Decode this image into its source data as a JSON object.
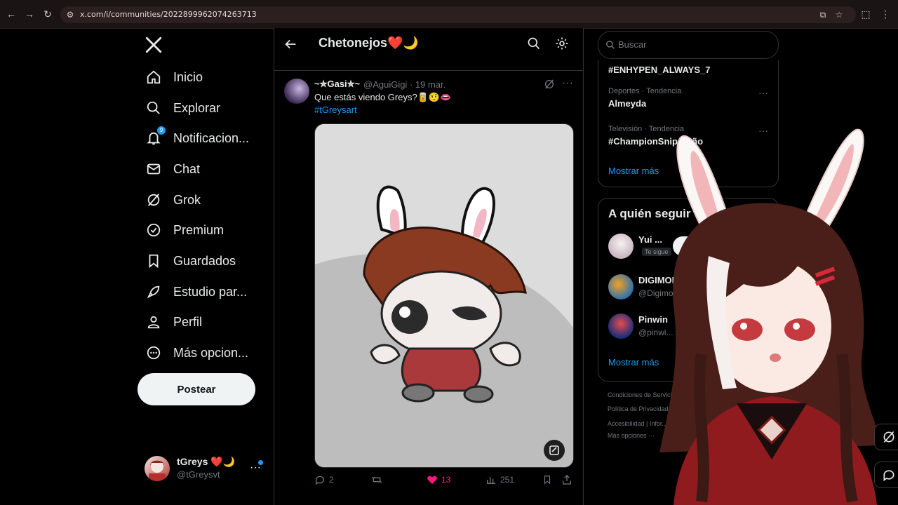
{
  "browser": {
    "url": "x.com/i/communities/2022899962074263713"
  },
  "sidebar": {
    "items": [
      {
        "label": "Inicio",
        "icon": "home-icon"
      },
      {
        "label": "Explorar",
        "icon": "search-icon"
      },
      {
        "label": "Notificacion...",
        "icon": "bell-icon",
        "badge": "9"
      },
      {
        "label": "Chat",
        "icon": "mail-icon"
      },
      {
        "label": "Grok",
        "icon": "grok-icon"
      },
      {
        "label": "Premium",
        "icon": "verified-icon"
      },
      {
        "label": "Guardados",
        "icon": "bookmark-icon"
      },
      {
        "label": "Estudio par...",
        "icon": "rocket-icon"
      },
      {
        "label": "Perfil",
        "icon": "person-icon"
      },
      {
        "label": "Más opcion...",
        "icon": "more-circle-icon"
      }
    ],
    "post_label": "Postear",
    "account": {
      "name": "tGreys ❤️🌙",
      "handle": "@tGreysvt"
    }
  },
  "center": {
    "title": "Chetonejos❤️🌙",
    "tweet": {
      "name": "~✮Gasi✮~",
      "handle": "@AguiGigi · 19 mar.",
      "text": "Que estás viendo Greys?🥫🤨👄",
      "hashtag": "#tGreysart",
      "replies": "2",
      "likes": "13",
      "views": "251"
    }
  },
  "right": {
    "search_placeholder": "Buscar",
    "trends": [
      {
        "meta": "",
        "name": "#ENHYPEN_ALWAYS_7"
      },
      {
        "meta": "Deportes · Tendencia",
        "name": "Almeyda"
      },
      {
        "meta": "Televisión · Tendencia",
        "name": "#ChampionSnip...Año"
      }
    ],
    "show_more": "Mostrar más",
    "who_to_follow": {
      "title": "A quién seguir",
      "users": [
        {
          "name": "Yui ...",
          "tag": "Te sigue",
          "button": "Seguir"
        },
        {
          "name": "DIGIMON UP",
          "handle": "@Digimon_up"
        },
        {
          "name": "Pinwin",
          "handle": "@pinwi..."
        }
      ],
      "show_more": "Mostrar más"
    },
    "footer": [
      "Condiciones de Servicio",
      "Política de Privacidad",
      "Accesibilidad  |  Infor...",
      "Más opciones ···"
    ]
  },
  "colors": {
    "accent": "#1d9bf0",
    "like": "#f91880",
    "background": "#000000"
  }
}
